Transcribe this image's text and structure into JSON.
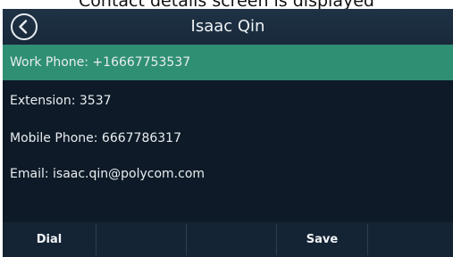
{
  "caption": "Contact details screen is displayed",
  "header": {
    "back_icon": "chevron-left-icon",
    "title": "Isaac Qin"
  },
  "details": [
    {
      "text": "Work Phone: +16667753537",
      "selected": true
    },
    {
      "text": "Extension: 3537",
      "selected": false
    },
    {
      "text": "Mobile Phone: 6667786317",
      "selected": false
    },
    {
      "text": "Email: isaac.qin@polycom.com",
      "selected": false
    }
  ],
  "softkeys": {
    "dial_label": "Dial",
    "save_label": "Save"
  },
  "colors": {
    "screen_background": "#0e1a27",
    "selected_row": "#2f8f73",
    "header": "#1b2d40"
  }
}
